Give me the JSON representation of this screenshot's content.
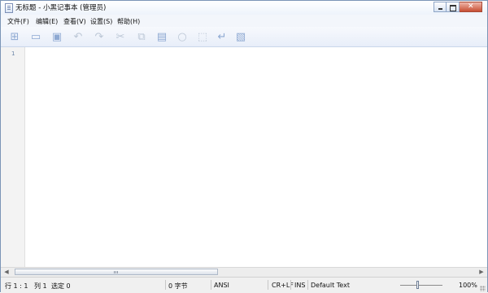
{
  "window": {
    "title": "无标题 - 小黑记事本 (管理员)"
  },
  "menu": [
    {
      "label": "文件(F)"
    },
    {
      "label": "编辑(E)"
    },
    {
      "label": "查看(V)"
    },
    {
      "label": "设置(S)"
    },
    {
      "label": "帮助(H)"
    }
  ],
  "toolbar": {
    "icons": [
      "new-file-icon",
      "open-folder-icon",
      "save-icon",
      "undo-icon",
      "redo-icon",
      "cut-icon",
      "copy-icon",
      "paste-icon",
      "find-icon",
      "replace-icon",
      "word-wrap-icon",
      "settings-icon"
    ]
  },
  "editor": {
    "line_number": "1"
  },
  "status": {
    "line": "行 1 : 1",
    "column": "列 1",
    "selection": "选定 0",
    "bytes": "0 字节",
    "encoding": "ANSI",
    "line_ending": "CR+LF",
    "insert_mode": "INS",
    "text_type": "Default Text",
    "zoom": "100%"
  }
}
